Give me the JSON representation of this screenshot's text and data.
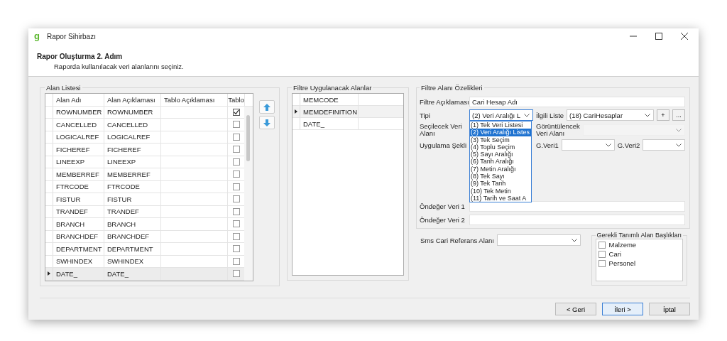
{
  "window": {
    "logo": "g",
    "title": "Rapor Sihirbazı"
  },
  "header": {
    "title": "Rapor Oluşturma 2. Adım",
    "subtitle": "Raporda kullanılacak veri alanlarını seçiniz."
  },
  "field_list": {
    "title": "Alan Listesi",
    "columns": [
      "Alan Adı",
      "Alan Açıklaması",
      "Tablo Açıklaması",
      "Tablo"
    ],
    "rows": [
      {
        "name": "ROWNUMBER",
        "description": "ROWNUMBER",
        "checked": true,
        "selected": false
      },
      {
        "name": "CANCELLED",
        "description": "CANCELLED",
        "checked": false,
        "selected": false
      },
      {
        "name": "LOGICALREF",
        "description": "LOGICALREF",
        "checked": false,
        "selected": false
      },
      {
        "name": "FICHEREF",
        "description": "FICHEREF",
        "checked": false,
        "selected": false
      },
      {
        "name": "LINEEXP",
        "description": "LINEEXP",
        "checked": false,
        "selected": false
      },
      {
        "name": "MEMBERREF",
        "description": "MEMBERREF",
        "checked": false,
        "selected": false
      },
      {
        "name": "FTRCODE",
        "description": "FTRCODE",
        "checked": false,
        "selected": false
      },
      {
        "name": "FISTUR",
        "description": "FISTUR",
        "checked": false,
        "selected": false
      },
      {
        "name": "TRANDEF",
        "description": "TRANDEF",
        "checked": false,
        "selected": false
      },
      {
        "name": "BRANCH",
        "description": "BRANCH",
        "checked": false,
        "selected": false
      },
      {
        "name": "BRANCHDEF",
        "description": "BRANCHDEF",
        "checked": false,
        "selected": false
      },
      {
        "name": "DEPARTMENT",
        "description": "DEPARTMENT",
        "checked": false,
        "selected": false
      },
      {
        "name": "SWHINDEX",
        "description": "SWHINDEX",
        "checked": false,
        "selected": false
      },
      {
        "name": "DATE_",
        "description": "DATE_",
        "checked": false,
        "selected": true
      }
    ]
  },
  "filter_fields": {
    "title": "Filtre Uygulanacak Alanlar",
    "rows": [
      {
        "name": "MEMCODE",
        "selected": false
      },
      {
        "name": "MEMDEFINITION",
        "selected": true
      },
      {
        "name": "DATE_",
        "selected": false
      }
    ]
  },
  "filter_properties": {
    "title": "Filtre Alanı Özelikleri",
    "description": {
      "label": "Filtre Açıklaması",
      "value": "Cari Hesap Adı"
    },
    "type": {
      "label": "Tipi",
      "value": "(2) Veri Aralığı L",
      "options": [
        {
          "label": "(1) Tek Veri Listesi",
          "selected": false
        },
        {
          "label": "(2) Veri Aralığı Listes",
          "selected": true
        },
        {
          "label": "(3) Tek Seçim",
          "selected": false
        },
        {
          "label": "(4) Toplu Seçim",
          "selected": false
        },
        {
          "label": "(5) Sayı Aralığı",
          "selected": false
        },
        {
          "label": "(6) Tarih Aralığı",
          "selected": false
        },
        {
          "label": "(7) Metin Aralığı",
          "selected": false
        },
        {
          "label": "(8) Tek Sayı",
          "selected": false
        },
        {
          "label": "(9) Tek Tarih",
          "selected": false
        },
        {
          "label": "(10) Tek Metin",
          "selected": false
        },
        {
          "label": "(11) Tarih ve Saat A",
          "selected": false
        }
      ]
    },
    "related_list": {
      "label": "İlgili Liste",
      "value": "(18) CariHesaplar",
      "buttons": [
        "+",
        "..."
      ]
    },
    "select_field": {
      "label": "Seçilecek Veri Alanı"
    },
    "display_field": {
      "label": "Görüntülencek Veri Alanı",
      "disabled": true
    },
    "apply_mode": {
      "label": "Uygulama Şekli"
    },
    "g_veri1": {
      "label": "G.Veri1"
    },
    "g_veri2": {
      "label": "G.Veri2"
    },
    "default1": {
      "label": "Öndeğer Veri 1"
    },
    "default2": {
      "label": "Öndeğer Veri 2"
    }
  },
  "sms_field": {
    "label": "Sms Cari Referans Alanı"
  },
  "required_headers": {
    "title": "Gerekli Tanımlı Alan Başlıkları",
    "items": [
      {
        "label": "Malzeme",
        "checked": false
      },
      {
        "label": "Cari",
        "checked": false
      },
      {
        "label": "Personel",
        "checked": false
      }
    ]
  },
  "buttons": [
    {
      "label": "< Geri",
      "kind": "back"
    },
    {
      "label": "İleri >",
      "kind": "default"
    },
    {
      "label": "İptal",
      "kind": "cancel"
    }
  ]
}
